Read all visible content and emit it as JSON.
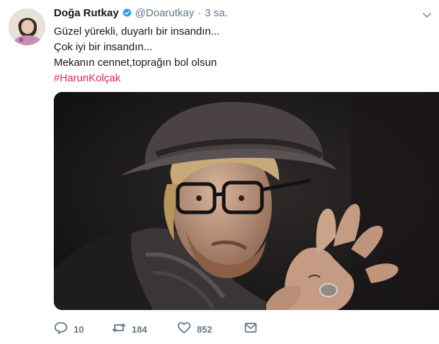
{
  "author": {
    "display_name": "Doğa Rutkay",
    "handle": "@Doarutkay",
    "separator": "·",
    "time_ago": "3 sa."
  },
  "tweet": {
    "lines": [
      "Güzel yürekli, duyarlı bir insandın...",
      "Çok iyi bir insandın...",
      "Mekanın cennet,toprağın bol olsun"
    ],
    "hashtag": "#HarunKolçak"
  },
  "actions": {
    "reply_count": "10",
    "retweet_count": "184",
    "like_count": "852"
  },
  "colors": {
    "hashtag": "#e0245e",
    "verified": "#1da1f2",
    "muted": "#657786"
  },
  "icons": [
    "verified-badge-icon",
    "chevron-down-icon",
    "reply-icon",
    "retweet-icon",
    "like-icon",
    "direct-message-icon"
  ]
}
